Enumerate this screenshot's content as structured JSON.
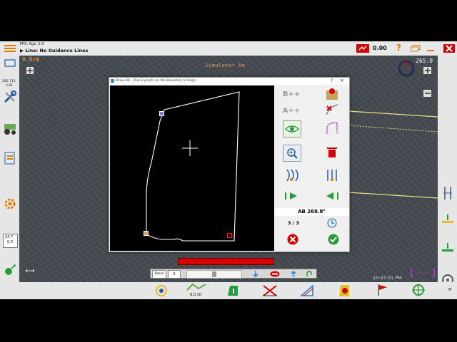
{
  "status": {
    "pps_age": "PPS: Age: 0.0",
    "line_label": "▶ Line: No Guidance Lines",
    "cross_track": "0.00",
    "heading": "265.9",
    "distance": "0.0cm",
    "simulator": "Simulator On"
  },
  "left_readouts": {
    "speed_top": "266.713",
    "speed_bottom": "2.91",
    "section_top": "24.7",
    "section_bottom": "0.0"
  },
  "dialog": {
    "title": "Draw AB - Click 2 points on the Boundary to Begin",
    "close": "×",
    "help": "?",
    "tool_b_plus": "B++",
    "tool_a_plus": "A++",
    "heading_label": "AB 269.8°",
    "point_count": "3 / 3"
  },
  "bottom": {
    "steer_version": "6.0.10",
    "reset_label": "Reset",
    "offset_value": "0",
    "clock": "10:47:31 PM",
    "right_m": "M"
  },
  "colors": {
    "field": "#444a4f",
    "boundary": "#ffffff",
    "accent_red": "#d40000",
    "guide_yellow": "#e6e08a"
  }
}
